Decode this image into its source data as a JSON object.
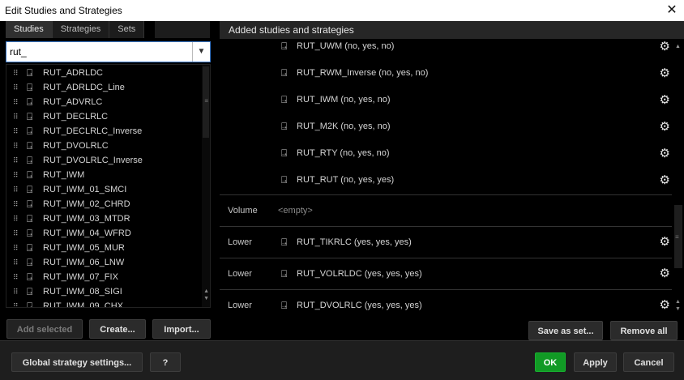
{
  "window": {
    "title": "Edit Studies and Strategies",
    "close_glyph": "✕"
  },
  "tabs": [
    {
      "label": "Studies",
      "active": true
    },
    {
      "label": "Strategies",
      "active": false
    },
    {
      "label": "Sets",
      "active": false
    }
  ],
  "search": {
    "value": "rut_"
  },
  "studies": [
    "RUT_ADRLDC",
    "RUT_ADRLDC_Line",
    "RUT_ADVRLC",
    "RUT_DECLRLC",
    "RUT_DECLRLC_Inverse",
    "RUT_DVOLRLC",
    "RUT_DVOLRLC_Inverse",
    "RUT_IWM",
    "RUT_IWM_01_SMCI",
    "RUT_IWM_02_CHRD",
    "RUT_IWM_03_MTDR",
    "RUT_IWM_04_WFRD",
    "RUT_IWM_05_MUR",
    "RUT_IWM_06_LNW",
    "RUT_IWM_07_FIX",
    "RUT_IWM_08_SIGI",
    "RUT_IWM_09_CHX"
  ],
  "left_buttons": {
    "add_selected": "Add selected",
    "create": "Create...",
    "import": "Import..."
  },
  "added": {
    "header": "Added studies and strategies",
    "strategies": [
      "RUT_UWM (no, yes, no)",
      "RUT_RWM_Inverse (no, yes, no)",
      "RUT_IWM (no, yes, no)",
      "RUT_M2K (no, yes, no)",
      "RUT_RTY (no, yes, no)",
      "RUT_RUT (no, yes, yes)"
    ],
    "volume": {
      "kind": "Volume",
      "value": "<empty>"
    },
    "lower": [
      {
        "kind": "Lower",
        "label": "RUT_TIKRLC (yes, yes, yes)"
      },
      {
        "kind": "Lower",
        "label": "RUT_VOLRLDC (yes, yes, yes)"
      },
      {
        "kind": "Lower",
        "label": "RUT_DVOLRLC (yes, yes, yes)"
      }
    ]
  },
  "right_buttons": {
    "save_as_set": "Save as set...",
    "remove_all": "Remove all"
  },
  "footer": {
    "global_settings": "Global strategy settings...",
    "help": "?",
    "ok": "OK",
    "apply": "Apply",
    "cancel": "Cancel"
  },
  "icons": {
    "study": "study-script-icon",
    "grip": "drag-grip-icon",
    "gear": "gear-icon",
    "dropdown": "chevron-down-icon"
  },
  "colors": {
    "ok_green": "#119a25",
    "focus_blue": "#3a78c8",
    "background": "#000000"
  }
}
